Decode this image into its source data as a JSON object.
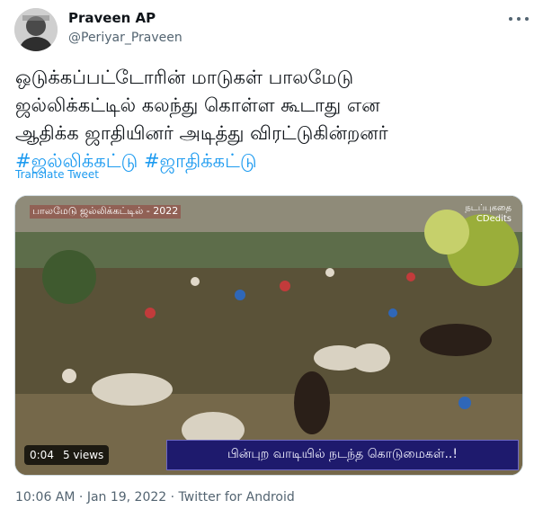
{
  "author": {
    "name": "Praveen AP",
    "handle": "@Periyar_Praveen"
  },
  "tweet": {
    "lines": [
      "ஒடுக்கப்பட்டோரின் மாடுகள் பாலமேடு",
      "ஜல்லிக்கட்டில் கலந்து கொள்ள கூடாது என",
      "ஆதிக்க ஜாதியினர் அடித்து விரட்டுகின்றனர்"
    ],
    "hashtags": [
      "#ஜல்லிக்கட்டு",
      "#ஜாதிக்கட்டு"
    ],
    "translate_label": "Translate Tweet"
  },
  "video": {
    "title_overlay": "பாலமேடு ஜல்லிக்கட்டில் - 2022",
    "brand_overlay": "நடப்புகதை\nCDedits",
    "banner_text": "பின்புற வாடியில் நடந்த கொடுமைகள்..!",
    "duration": "0:04",
    "views": "5 views"
  },
  "meta": {
    "time": "10:06 AM",
    "separator1": "·",
    "date": "Jan 19, 2022",
    "separator2": "·",
    "source": "Twitter for Android"
  },
  "icons": {
    "more": "more-dots-icon",
    "avatar": "avatar-image"
  },
  "colors": {
    "link": "#1d9bf0",
    "secondary_text": "#536471",
    "banner_bg": "#1e1a6d"
  }
}
